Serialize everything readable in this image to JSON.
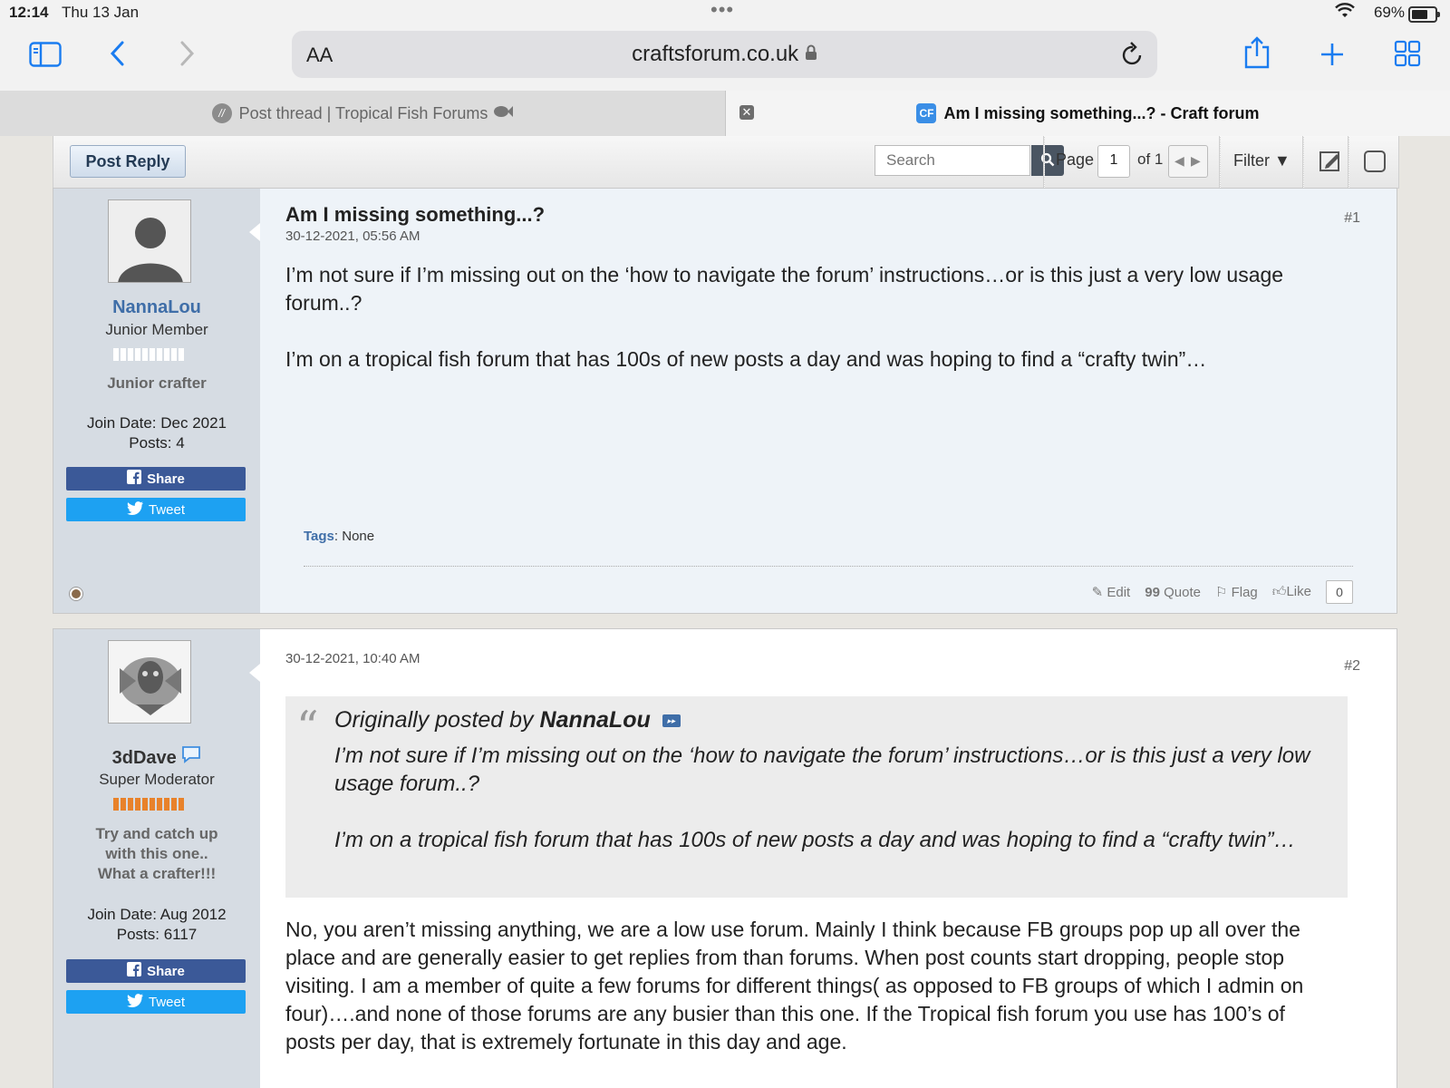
{
  "status": {
    "time": "12:14",
    "date": "Thu 13 Jan",
    "battery": "69%"
  },
  "browser": {
    "aa_label": "AA",
    "domain": "craftsforum.co.uk",
    "tabs": [
      {
        "title": "Post thread | Tropical Fish Forums"
      },
      {
        "title": "Am I missing something...? - Craft forum",
        "favicon": "CF"
      }
    ]
  },
  "forum_toolbar": {
    "post_reply": "Post Reply",
    "search_placeholder": "Search",
    "page_label": "Page",
    "page_value": "1",
    "page_of": "of 1",
    "filter_label": "Filter"
  },
  "posts": [
    {
      "title": "Am I missing something...?",
      "date": "30-12-2021, 05:56 AM",
      "number": "#1",
      "user": {
        "name": "NannaLou",
        "title": "Junior Member",
        "rank_text": "Junior crafter",
        "join_date": "Join Date: Dec 2021",
        "posts": "Posts: 4",
        "rank_color": "#ffffff",
        "share": "Share",
        "tweet": "Tweet"
      },
      "paragraphs": [
        "I’m not sure if I’m missing out on the ‘how to navigate the forum’ instructions…or is this just a very low usage forum..?",
        "I’m on a tropical fish forum that has 100s of new posts a day and was hoping to find a “crafty twin”…"
      ],
      "tags_label": "Tags",
      "tags_value": ": None",
      "actions": {
        "edit": "Edit",
        "quote": "Quote",
        "flag": "Flag",
        "like": "Like",
        "like_count": "0"
      }
    },
    {
      "date": "30-12-2021, 10:40 AM",
      "number": "#2",
      "user": {
        "name": "3dDave",
        "title": "Super Moderator",
        "rank_text_1": "Try and catch up",
        "rank_text_2": "with this one..",
        "rank_text_3": "What a crafter!!!",
        "join_date": "Join Date: Aug 2012",
        "posts": "Posts: 6117",
        "rank_color": "#e8822a",
        "share": "Share",
        "tweet": "Tweet"
      },
      "quote": {
        "prefix": "Originally posted by",
        "author": "NannaLou",
        "paragraphs": [
          "I’m not sure if I’m missing out on the ‘how to navigate the forum’ instructions…or is this just a very low usage forum..?",
          "I’m on a tropical fish forum that has 100s of new posts a day and was hoping to find a “crafty twin”…"
        ]
      },
      "body": "No, you aren’t missing anything, we are a low use forum. Mainly I think because FB groups pop up all over the place and are generally easier to get replies from than forums. When post counts start dropping, people stop visiting. I am a member of quite a few forums for different things( as opposed to FB groups of which I admin on four)….and none of those forums are any busier than this one. If the Tropical fish forum you use has 100’s of posts per day, that is extremely fortunate in this day and age."
    }
  ]
}
